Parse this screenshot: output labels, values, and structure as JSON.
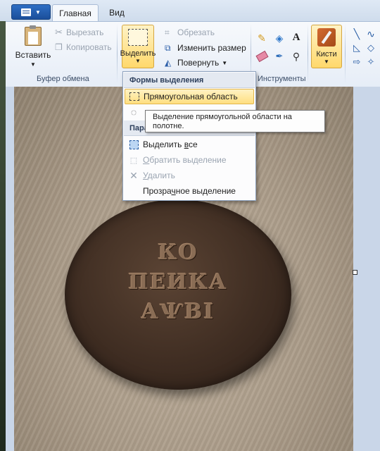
{
  "tabs": [
    {
      "label": "Главная",
      "active": true
    },
    {
      "label": "Вид",
      "active": false
    }
  ],
  "clipboard_group": {
    "paste_label": "Вставить",
    "cut_label": "Вырезать",
    "copy_label": "Копировать",
    "group_label": "Буфер обмена"
  },
  "image_group": {
    "select_label": "Выделить",
    "crop_label": "Обрезать",
    "resize_label": "Изменить размер",
    "rotate_label": "Повернуть"
  },
  "tools_group": {
    "group_label": "Инструменты",
    "brushes_label": "Кисти"
  },
  "select_menu": {
    "shapes_header": "Формы выделения",
    "rect_label": "Прямоугольная область",
    "params_header": "Пара",
    "select_all_prefix": "Выделить ",
    "select_all_accel": "в",
    "select_all_suffix": "се",
    "invert_accel": "О",
    "invert_rest": "братить выделение",
    "delete_accel": "У",
    "delete_rest": "далить",
    "transparent_prefix": "Прозра",
    "transparent_accel": "ч",
    "transparent_suffix": "ное выделение"
  },
  "tooltip": {
    "line1": "Выделение прямоугольной области на",
    "line2": "полотне."
  },
  "coin_inscription": {
    "line1": "КО",
    "line2": "ПЕИКА",
    "line3": "АѰВІ"
  },
  "colors": {
    "ribbon_bg": "#e6edf7",
    "highlight": "#ffd86b",
    "app_button": "#1b4f9b"
  }
}
